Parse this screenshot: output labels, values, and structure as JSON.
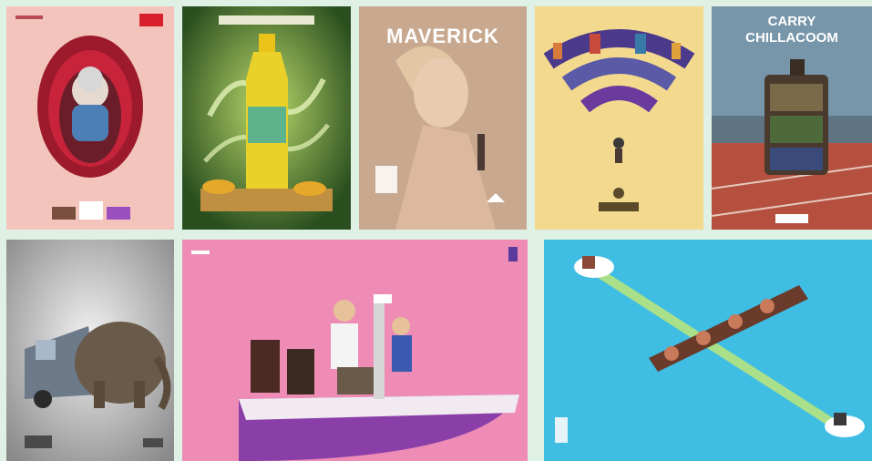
{
  "gallery": {
    "tiles": [
      {
        "id": "t1",
        "subject": "open-mouth-portrait",
        "colors": {
          "bg": "#f3c4bb",
          "accent": "#b3203a"
        }
      },
      {
        "id": "t2",
        "subject": "juice-bottle-swirl",
        "colors": {
          "bg": "#2e5a22",
          "accent": "#e8d21e"
        }
      },
      {
        "id": "t3",
        "subject": "magazine-cover-woman",
        "title": "MAVERICK",
        "colors": {
          "bg": "#c8a98f",
          "accent": "#ffffff"
        }
      },
      {
        "id": "t4",
        "subject": "wifi-city-illustration",
        "colors": {
          "bg": "#f3d98e",
          "accent": "#4b3a8c"
        }
      },
      {
        "id": "t5",
        "subject": "suitcase-city-track",
        "title_line1": "CARRY",
        "title_line2": "CHILLACOOM",
        "colors": {
          "bg": "#6e8ea3",
          "accent": "#c74b3a"
        }
      },
      {
        "id": "t6",
        "subject": "van-elephant",
        "colors": {
          "bg": "#c8c8c8",
          "accent": "#6c7a8a"
        }
      },
      {
        "id": "t7",
        "subject": "office-on-ship",
        "colors": {
          "bg": "#ee8cb6",
          "accent": "#8a3fa8"
        }
      },
      {
        "id": "t8",
        "subject": "boat-relay-laser",
        "colors": {
          "bg": "#3fbde2",
          "accent": "#d8f064"
        }
      }
    ]
  }
}
